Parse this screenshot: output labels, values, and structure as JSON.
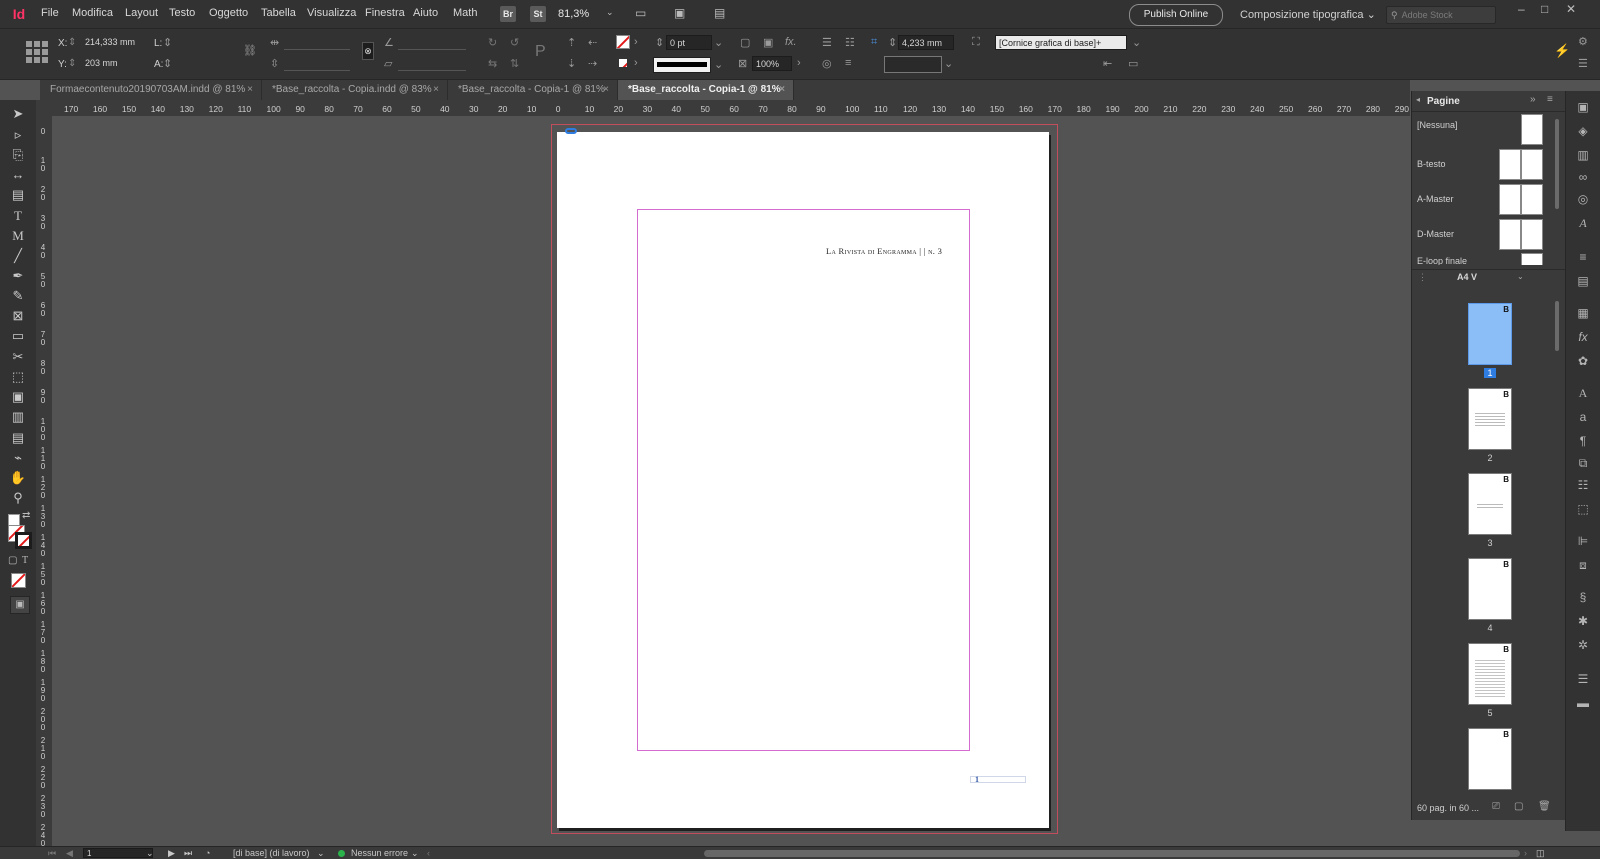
{
  "app": {
    "logo": "Id"
  },
  "menu": {
    "items": [
      "File",
      "Modifica",
      "Layout",
      "Testo",
      "Oggetto",
      "Tabella",
      "Visualizza",
      "Finestra",
      "Aiuto",
      "Math"
    ],
    "bridge": "Br",
    "stock": "St",
    "zoom": "81,3%",
    "publish": "Publish Online",
    "workspace": "Composizione tipografica",
    "search_placeholder": "Adobe Stock"
  },
  "control": {
    "x_label": "X:",
    "x_value": "214,333 mm",
    "y_label": "Y:",
    "y_value": "203 mm",
    "l_label": "L:",
    "a_label": "A:",
    "stroke_weight": "0 pt",
    "opacity": "100%",
    "spacing": "4,233 mm",
    "object_style": "[Cornice grafica di base]+"
  },
  "tabs": [
    {
      "label": "Formaecontenuto20190703AM.indd @ 81%"
    },
    {
      "label": "*Base_raccolta - Copia.indd @ 83%"
    },
    {
      "label": "*Base_raccolta - Copia-1 @ 81%"
    },
    {
      "label": "*Base_raccolta - Copia-1 @ 81%"
    }
  ],
  "ruler_h": [
    "170",
    "160",
    "150",
    "140",
    "130",
    "120",
    "110",
    "100",
    "90",
    "80",
    "70",
    "60",
    "50",
    "40",
    "30",
    "20",
    "10",
    "0",
    "10",
    "20",
    "30",
    "40",
    "50",
    "60",
    "70",
    "80",
    "90",
    "100",
    "110",
    "120",
    "130",
    "140",
    "150",
    "160",
    "170",
    "180",
    "190",
    "200",
    "210",
    "220",
    "230",
    "240",
    "250",
    "260",
    "270",
    "280",
    "290"
  ],
  "ruler_v": [
    "0",
    "1 0",
    "2 0",
    "3 0",
    "4 0",
    "5 0",
    "6 0",
    "7 0",
    "8 0",
    "9 0",
    "1 0 0",
    "1 1 0",
    "1 2 0",
    "1 3 0",
    "1 4 0",
    "1 5 0",
    "1 6 0",
    "1 7 0",
    "1 8 0",
    "1 9 0",
    "2 0 0",
    "2 1 0",
    "2 2 0",
    "2 3 0",
    "2 4 0"
  ],
  "document": {
    "running_header": "La Rivista di Engramma | | n. 3",
    "page_number": "1"
  },
  "pages_panel": {
    "title": "Pagine",
    "masters": [
      {
        "label": "[Nessuna]"
      },
      {
        "label": "B-testo"
      },
      {
        "label": "A-Master"
      },
      {
        "label": "D-Master"
      },
      {
        "label": "E-loop finale"
      }
    ],
    "page_size": "A4 V",
    "pages": [
      {
        "number": "1",
        "master": "B"
      },
      {
        "number": "2",
        "master": "B"
      },
      {
        "number": "3",
        "master": "B"
      },
      {
        "number": "4",
        "master": "B"
      },
      {
        "number": "5",
        "master": "B"
      },
      {
        "number": "",
        "master": "B"
      }
    ],
    "status": "60 pag. in 60 ..."
  },
  "statusbar": {
    "page": "1",
    "profile": "[di base] (di lavoro)",
    "errors": "Nessun errore"
  }
}
